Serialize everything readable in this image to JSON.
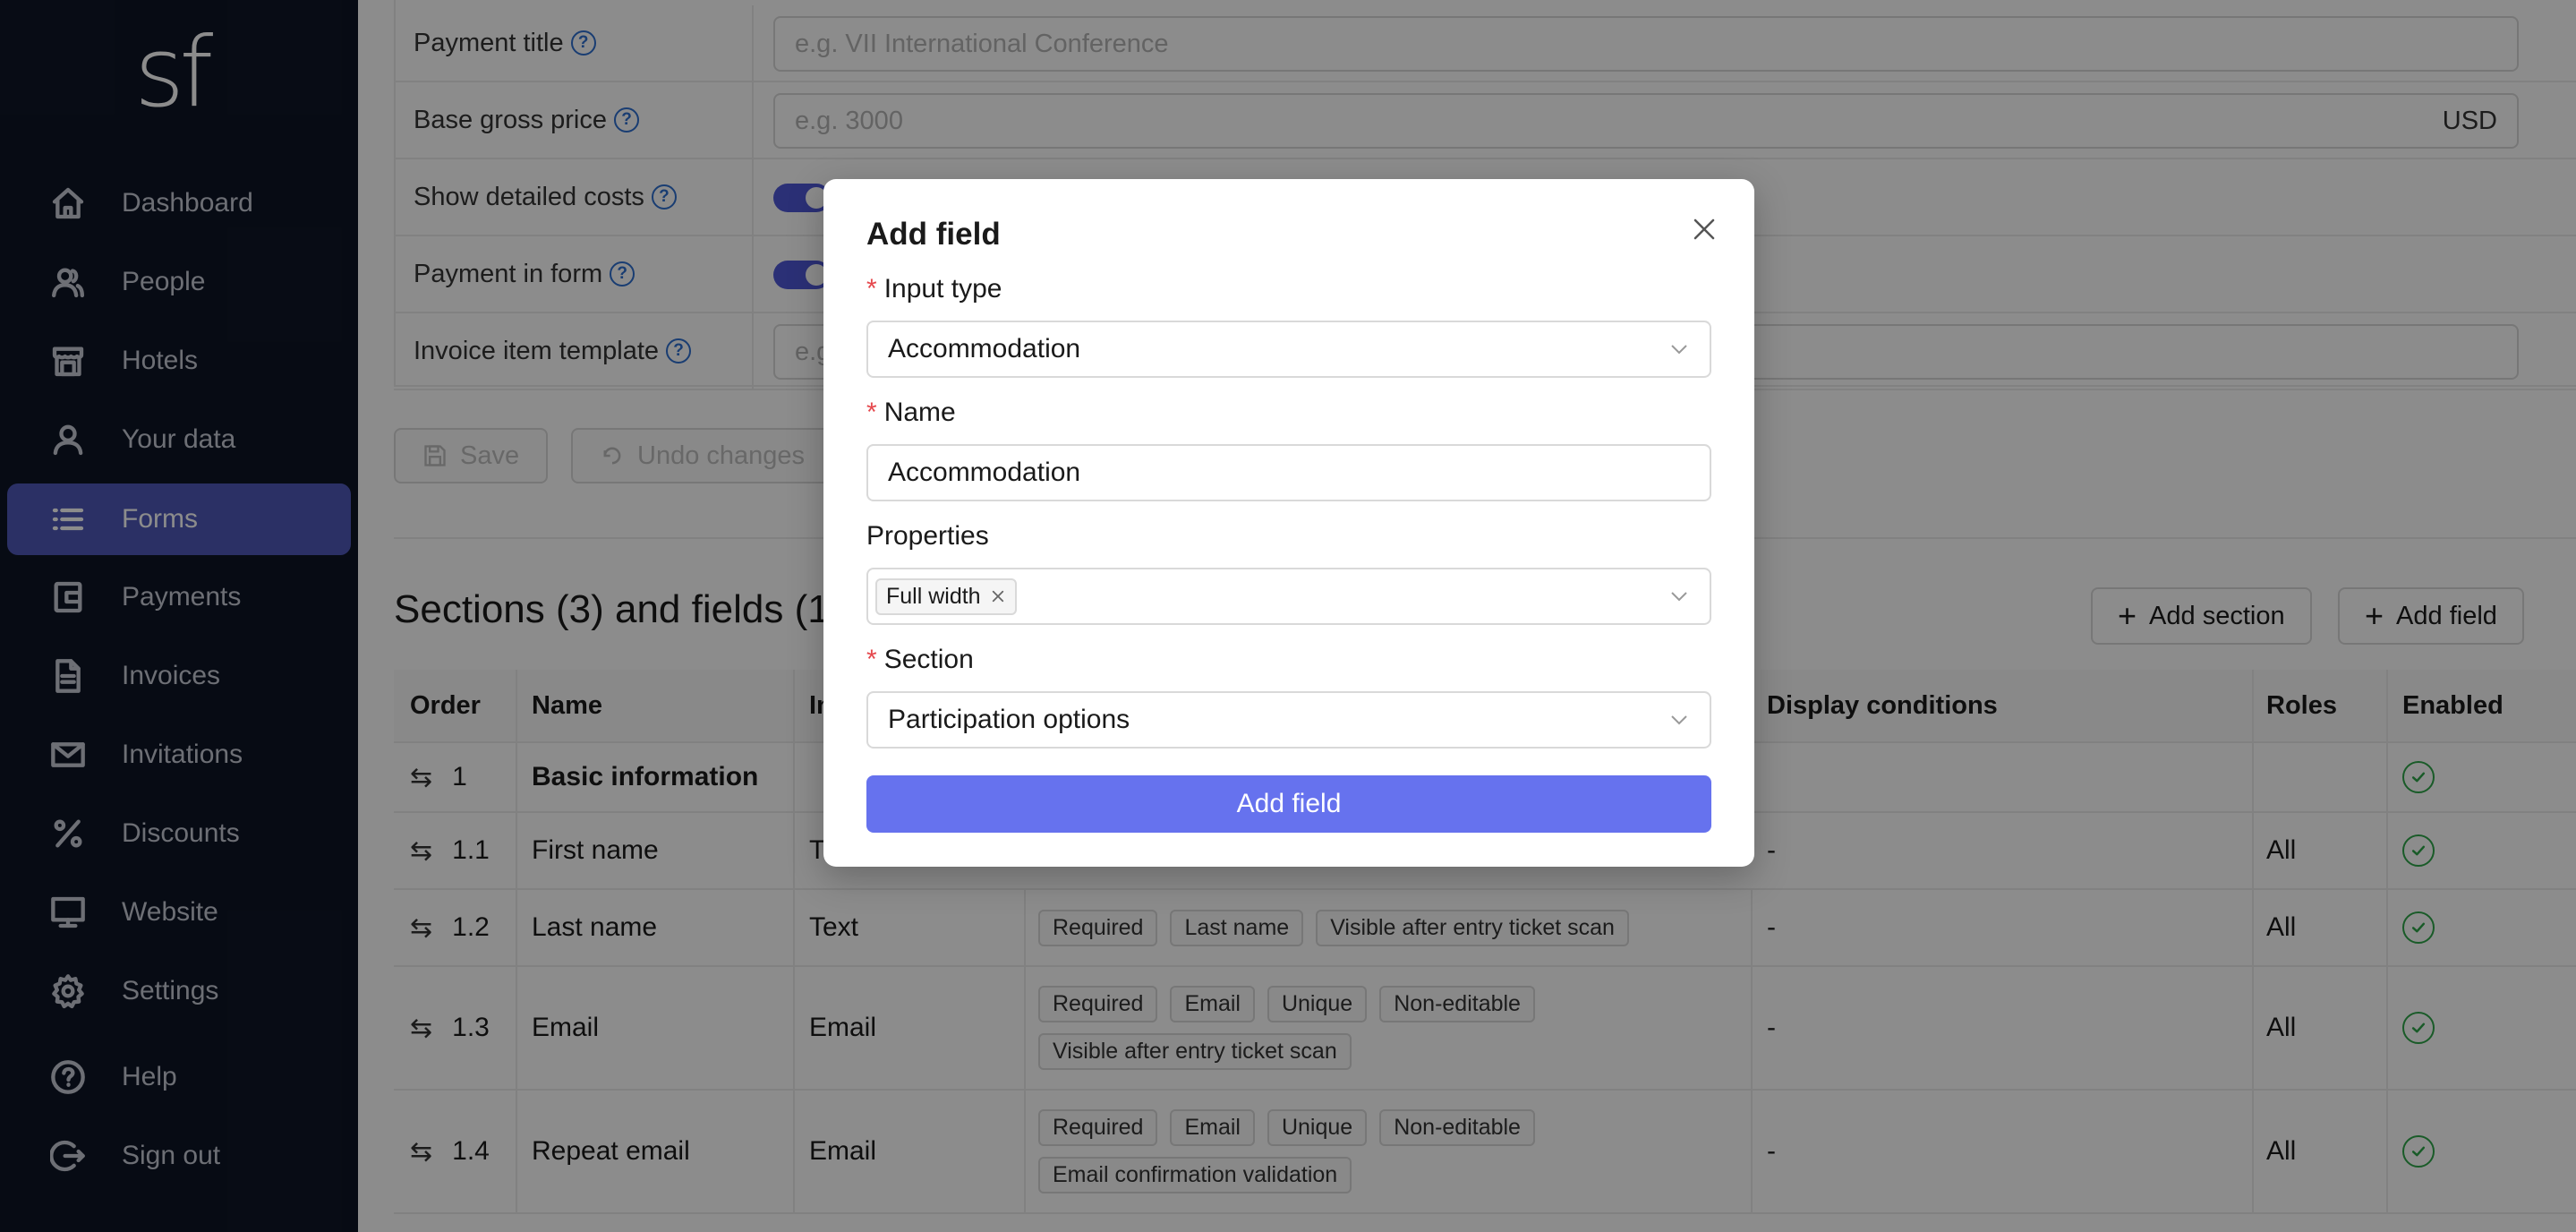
{
  "app": {
    "logo": "sf"
  },
  "sidebar": {
    "items": [
      {
        "label": "Dashboard",
        "icon": "home-icon"
      },
      {
        "label": "People",
        "icon": "people-icon"
      },
      {
        "label": "Hotels",
        "icon": "hotel-icon"
      },
      {
        "label": "Your data",
        "icon": "user-icon"
      },
      {
        "label": "Forms",
        "icon": "list-icon",
        "active": true
      },
      {
        "label": "Payments",
        "icon": "wallet-icon"
      },
      {
        "label": "Invoices",
        "icon": "document-icon"
      },
      {
        "label": "Invitations",
        "icon": "mail-icon"
      },
      {
        "label": "Discounts",
        "icon": "percent-icon"
      },
      {
        "label": "Website",
        "icon": "monitor-icon"
      },
      {
        "label": "Settings",
        "icon": "gear-icon"
      },
      {
        "label": "Help",
        "icon": "help-icon"
      },
      {
        "label": "Sign out",
        "icon": "sign-out-icon"
      }
    ]
  },
  "settings": {
    "payment_title": {
      "label": "Payment title",
      "placeholder": "e.g. VII International Conference"
    },
    "base_gross_price": {
      "label": "Base gross price",
      "placeholder": "e.g. 3000",
      "currency": "USD"
    },
    "show_detailed_costs": {
      "label": "Show detailed costs",
      "enabled": true
    },
    "payment_in_form": {
      "label": "Payment in form",
      "enabled": true
    },
    "invoice_item_template": {
      "label": "Invoice item template",
      "placeholder": "e.g."
    },
    "save_label": "Save",
    "undo_label": "Undo changes"
  },
  "sections": {
    "title": "Sections (3) and fields (1",
    "add_section_label": "Add section",
    "add_field_label": "Add field"
  },
  "table": {
    "headers": [
      "Order",
      "Name",
      "In",
      "Display conditions",
      "Roles",
      "Enabled"
    ],
    "rows": [
      {
        "order": "1",
        "name": "Basic information",
        "type": "",
        "tags": [],
        "conditions": "",
        "roles": "",
        "section": true
      },
      {
        "order": "1.1",
        "name": "First name",
        "type": "T",
        "tags": [],
        "conditions": "-",
        "roles": "All"
      },
      {
        "order": "1.2",
        "name": "Last name",
        "type": "Text",
        "tags": [
          "Required",
          "Last name",
          "Visible after entry ticket scan"
        ],
        "conditions": "-",
        "roles": "All"
      },
      {
        "order": "1.3",
        "name": "Email",
        "type": "Email",
        "tags": [
          "Required",
          "Email",
          "Unique",
          "Non-editable",
          "Visible after entry ticket scan"
        ],
        "conditions": "-",
        "roles": "All"
      },
      {
        "order": "1.4",
        "name": "Repeat email",
        "type": "Email",
        "tags": [
          "Required",
          "Email",
          "Unique",
          "Non-editable",
          "Email confirmation validation"
        ],
        "conditions": "-",
        "roles": "All"
      }
    ]
  },
  "modal": {
    "title": "Add field",
    "input_type": {
      "label": "Input type",
      "value": "Accommodation"
    },
    "name": {
      "label": "Name",
      "value": "Accommodation"
    },
    "properties": {
      "label": "Properties",
      "chips": [
        "Full width"
      ]
    },
    "section": {
      "label": "Section",
      "value": "Participation options"
    },
    "submit_label": "Add field"
  },
  "colors": {
    "sidebar_bg": "#0e1526",
    "active_nav": "#4f58b8",
    "primary_button": "#6672ee",
    "required_asterisk": "#e5484d",
    "enabled_check": "#2fa64a",
    "help_icon": "#2f6fd0"
  }
}
